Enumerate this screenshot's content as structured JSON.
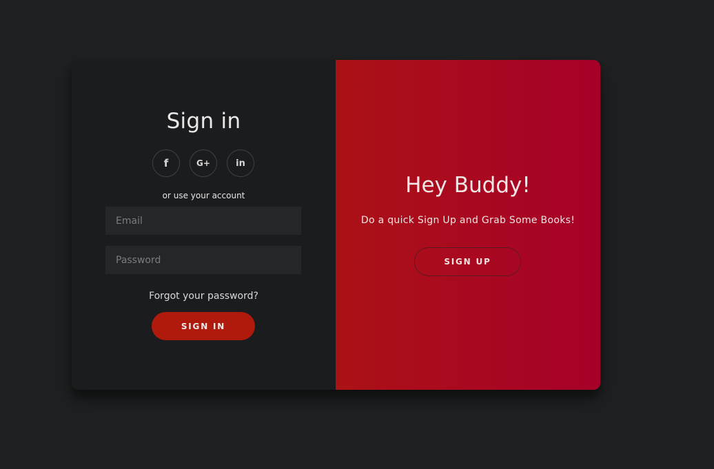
{
  "signin": {
    "title": "Sign in",
    "social": {
      "facebook": "f",
      "google": "G+",
      "linkedin": "in"
    },
    "subtext": "or use your account",
    "email_placeholder": "Email",
    "password_placeholder": "Password",
    "forgot_label": "Forgot your password?",
    "button_label": "SIGN IN"
  },
  "overlay": {
    "title": "Hey Buddy!",
    "text": "Do a quick Sign Up and Grab Some Books!",
    "button_label": "SIGN UP"
  },
  "colors": {
    "background": "#1e2021",
    "panel": "#1b1c1e",
    "accent_start": "#ab1216",
    "accent_end": "#a70029",
    "signin_button": "#b01a0c"
  },
  "icons": {
    "facebook": "facebook-icon",
    "google": "google-plus-icon",
    "linkedin": "linkedin-icon"
  }
}
